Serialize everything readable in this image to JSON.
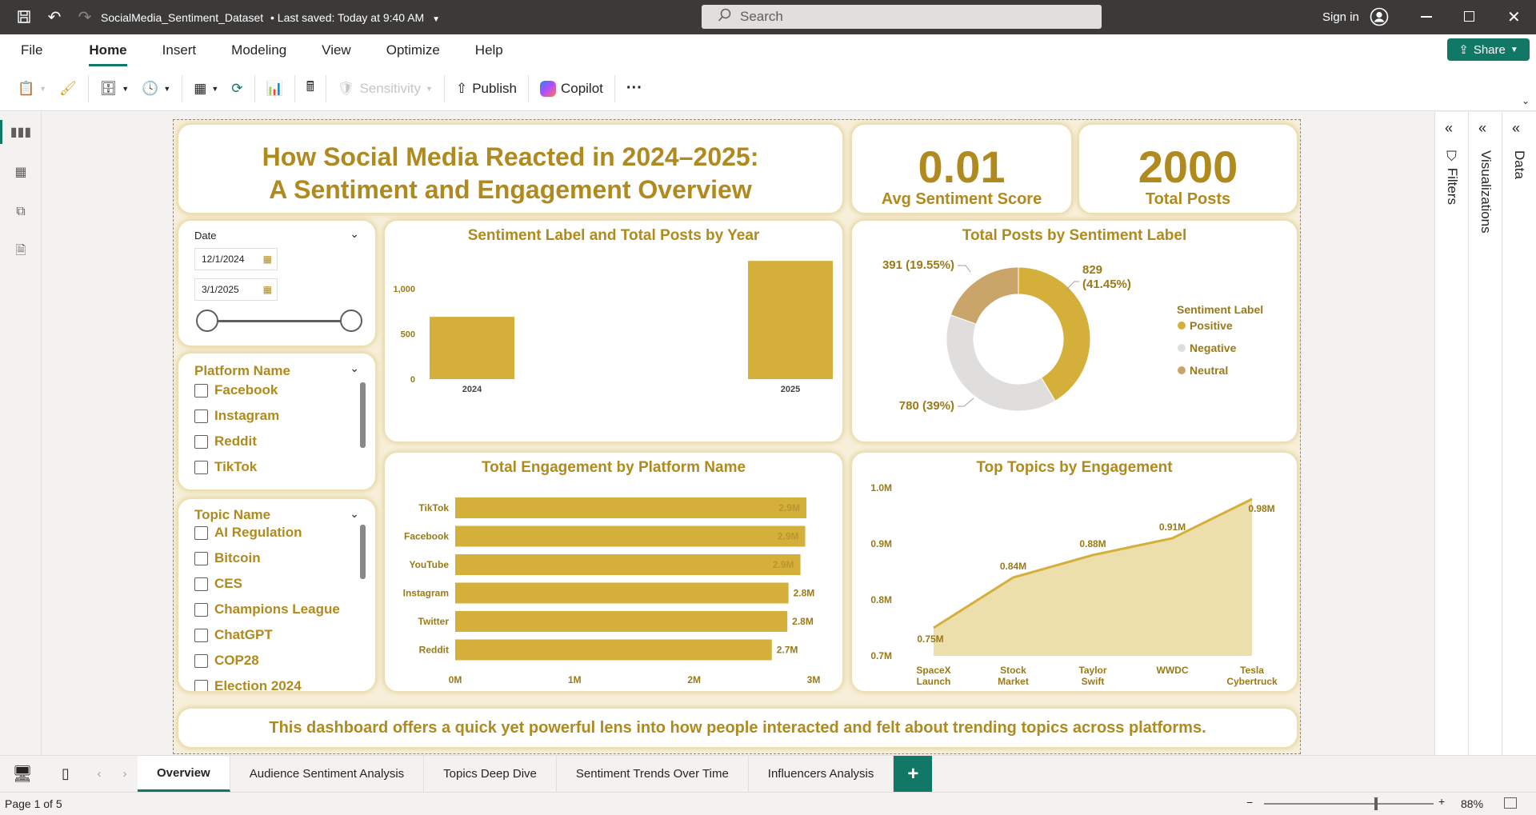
{
  "titlebar": {
    "doc_title": "SocialMedia_Sentiment_Dataset",
    "saved": "Last saved: Today at 9:40 AM",
    "search_placeholder": "Search",
    "signin": "Sign in"
  },
  "menu": {
    "items": [
      "File",
      "Home",
      "Insert",
      "Modeling",
      "View",
      "Optimize",
      "Help"
    ],
    "active": "Home",
    "share": "Share"
  },
  "toolbar": {
    "sensitivity": "Sensitivity",
    "publish": "Publish",
    "copilot": "Copilot",
    "more": "···"
  },
  "panes": {
    "filters": "Filters",
    "visualizations": "Visualizations",
    "data": "Data"
  },
  "report": {
    "title_line1": "How Social Media Reacted in 2024–2025:",
    "title_line2": "A Sentiment and Engagement Overview",
    "kpi1_value": "0.01",
    "kpi1_label": "Avg Sentiment Score",
    "kpi2_value": "2000",
    "kpi2_label": "Total Posts",
    "footer": "This dashboard offers a quick yet powerful lens into how people interacted and felt about trending topics across platforms."
  },
  "slicers": {
    "date": {
      "title": "Date",
      "start": "12/1/2024",
      "end": "3/1/2025"
    },
    "platform": {
      "title": "Platform Name",
      "options": [
        "Facebook",
        "Instagram",
        "Reddit",
        "TikTok"
      ]
    },
    "topic": {
      "title": "Topic Name",
      "options": [
        "AI Regulation",
        "Bitcoin",
        "CES",
        "Champions League",
        "ChatGPT",
        "COP28",
        "Election 2024"
      ]
    }
  },
  "chart_data": [
    {
      "type": "bar",
      "title": "Sentiment Label and Total Posts by Year",
      "categories": [
        "2024",
        "2025"
      ],
      "values": [
        690,
        1310
      ],
      "yticks": [
        "0",
        "500",
        "1,000"
      ],
      "ylim": [
        0,
        1400
      ],
      "color": "#d4b03b"
    },
    {
      "type": "pie",
      "title": "Total Posts by Sentiment Label",
      "legend_title": "Sentiment Label",
      "slices": [
        {
          "label": "Positive",
          "value": 829,
          "text": "829 (41.45%)",
          "color": "#d4b03b"
        },
        {
          "label": "Negative",
          "value": 780,
          "text": "780 (39%)",
          "color": "#e0dedc"
        },
        {
          "label": "Neutral",
          "value": 391,
          "text": "391 (19.55%)",
          "color": "#c9a56a"
        }
      ]
    },
    {
      "type": "bar",
      "title": "Total Engagement by Platform Name",
      "categories": [
        "TikTok",
        "Facebook",
        "YouTube",
        "Instagram",
        "Twitter",
        "Reddit"
      ],
      "values": [
        2.94,
        2.93,
        2.89,
        2.79,
        2.78,
        2.65
      ],
      "labels": [
        "2.9M",
        "2.9M",
        "2.9M",
        "2.8M",
        "2.8M",
        "2.7M"
      ],
      "xticks": [
        "0M",
        "1M",
        "2M",
        "3M"
      ],
      "xlim": [
        0,
        3
      ],
      "color": "#d4b03b"
    },
    {
      "type": "area",
      "title": "Top Topics by Engagement",
      "categories": [
        "SpaceX Launch",
        "Stock Market",
        "Taylor Swift",
        "WWDC",
        "Tesla Cybertruck"
      ],
      "values": [
        0.75,
        0.84,
        0.88,
        0.91,
        0.98
      ],
      "labels": [
        "0.75M",
        "0.84M",
        "0.88M",
        "0.91M",
        "0.98M"
      ],
      "yticks": [
        "0.7M",
        "0.8M",
        "0.9M",
        "1.0M"
      ],
      "ylim": [
        0.7,
        1.0
      ],
      "color": "#d4b03b"
    }
  ],
  "tabs": {
    "pages": [
      "Overview",
      "Audience Sentiment Analysis",
      "Topics Deep Dive",
      "Sentiment Trends Over Time",
      "Influencers Analysis"
    ],
    "active": "Overview",
    "add": "+"
  },
  "status": {
    "page": "Page 1 of 5",
    "zoom": "88%"
  }
}
